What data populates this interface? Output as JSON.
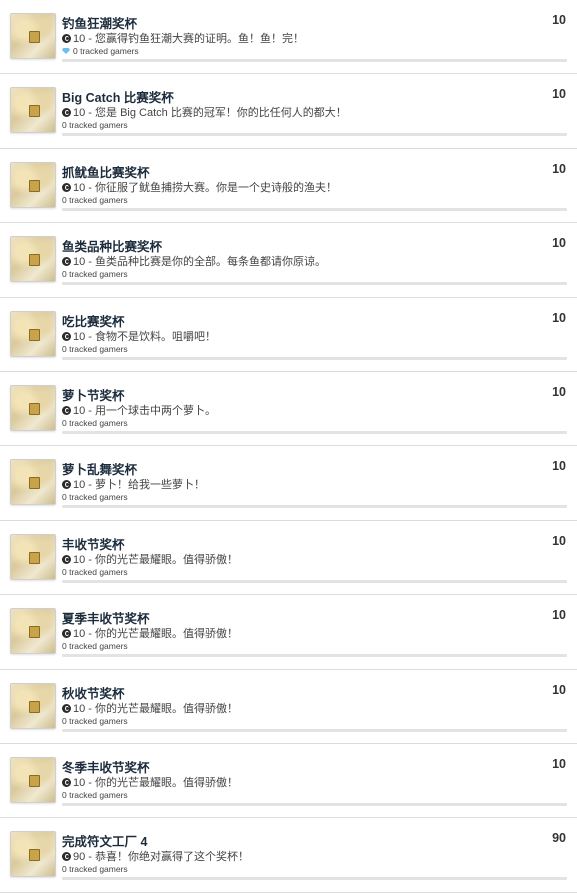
{
  "achievements": [
    {
      "title": "钓鱼狂潮奖杯",
      "points": "10",
      "desc": "10 - 您赢得钓鱼狂潮大赛的证明。鱼！鱼！完！",
      "tracked": "0 tracked gamers",
      "has_diamond": true,
      "progress": 0
    },
    {
      "title": "Big Catch 比赛奖杯",
      "points": "10",
      "desc": "10 - 您是 Big Catch 比赛的冠军！你的比任何人的都大！",
      "tracked": "0 tracked gamers",
      "has_diamond": false,
      "progress": 0
    },
    {
      "title": "抓鱿鱼比赛奖杯",
      "points": "10",
      "desc": "10 - 你征服了鱿鱼捕捞大赛。你是一个史诗般的渔夫！",
      "tracked": "0 tracked gamers",
      "has_diamond": false,
      "progress": 0
    },
    {
      "title": "鱼类品种比赛奖杯",
      "points": "10",
      "desc": "10 - 鱼类品种比赛是你的全部。每条鱼都请你原谅。",
      "tracked": "0 tracked gamers",
      "has_diamond": false,
      "progress": 0
    },
    {
      "title": "吃比赛奖杯",
      "points": "10",
      "desc": "10 - 食物不是饮料。咀嚼吧！",
      "tracked": "0 tracked gamers",
      "has_diamond": false,
      "progress": 0
    },
    {
      "title": "萝卜节奖杯",
      "points": "10",
      "desc": "10 - 用一个球击中两个萝卜。",
      "tracked": "0 tracked gamers",
      "has_diamond": false,
      "progress": 0
    },
    {
      "title": "萝卜乱舞奖杯",
      "points": "10",
      "desc": "10 - 萝卜！给我一些萝卜！",
      "tracked": "0 tracked gamers",
      "has_diamond": false,
      "progress": 0
    },
    {
      "title": "丰收节奖杯",
      "points": "10",
      "desc": "10 - 你的光芒最耀眼。值得骄傲！",
      "tracked": "0 tracked gamers",
      "has_diamond": false,
      "progress": 0
    },
    {
      "title": "夏季丰收节奖杯",
      "points": "10",
      "desc": "10 - 你的光芒最耀眼。值得骄傲！",
      "tracked": "0 tracked gamers",
      "has_diamond": false,
      "progress": 0
    },
    {
      "title": "秋收节奖杯",
      "points": "10",
      "desc": "10 - 你的光芒最耀眼。值得骄傲！",
      "tracked": "0 tracked gamers",
      "has_diamond": false,
      "progress": 0
    },
    {
      "title": "冬季丰收节奖杯",
      "points": "10",
      "desc": "10 - 你的光芒最耀眼。值得骄傲！",
      "tracked": "0 tracked gamers",
      "has_diamond": false,
      "progress": 0
    },
    {
      "title": "完成符文工厂 4",
      "points": "90",
      "desc": "90 - 恭喜！你绝对赢得了这个奖杯！",
      "tracked": "0 tracked gamers",
      "has_diamond": false,
      "progress": 0
    }
  ]
}
